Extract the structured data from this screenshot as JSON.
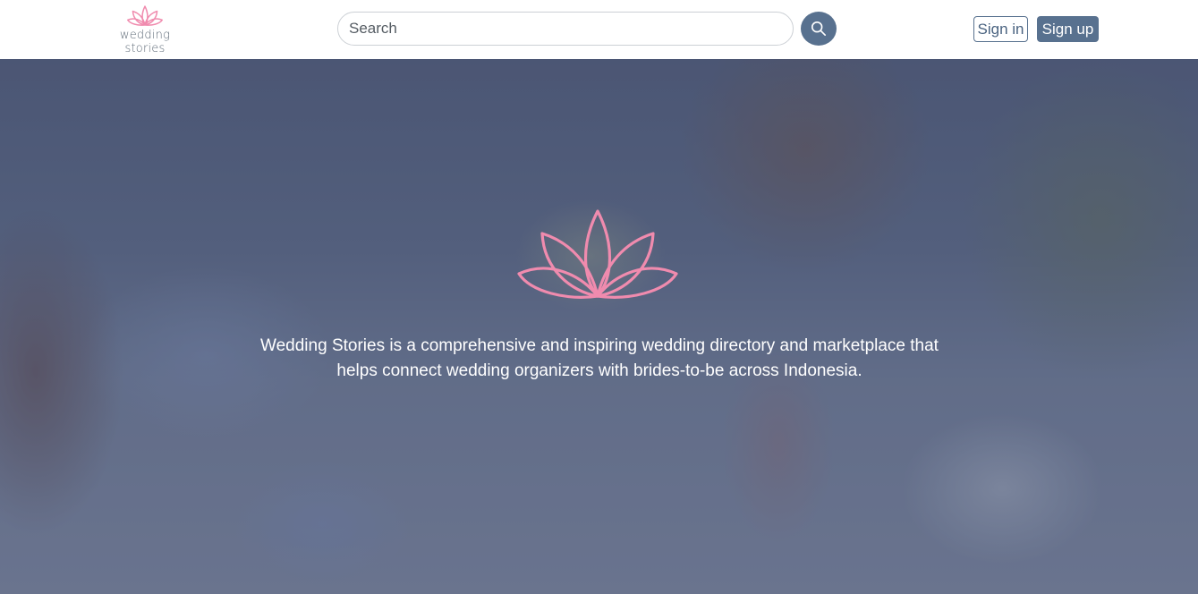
{
  "brand": {
    "name": "wedding stories",
    "accent_color": "#f08bae",
    "logo_icon": "lotus-icon"
  },
  "header": {
    "search": {
      "placeholder": "Search",
      "value": "",
      "icon": "search-icon"
    },
    "sign_in_label": "Sign in",
    "sign_up_label": "Sign up",
    "button_color": "#58718f"
  },
  "hero": {
    "icon": "lotus-icon",
    "tagline": "Wedding Stories is a comprehensive and inspiring wedding directory and marketplace that helps connect wedding organizers with brides-to-be across Indonesia."
  }
}
